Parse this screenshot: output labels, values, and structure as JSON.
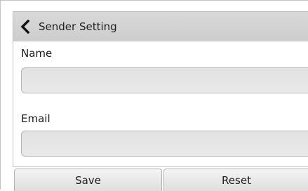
{
  "header": {
    "back_icon": "chevron-left-icon",
    "title": "Sender Setting"
  },
  "form": {
    "name_label": "Name",
    "name_value": "",
    "email_label": "Email",
    "email_value": ""
  },
  "footer": {
    "save_label": "Save",
    "reset_label": "Reset"
  },
  "colors": {
    "header_bg": "#d3d3d3",
    "field_bg": "#e6e6e6",
    "button_bg": "#e8e8e8"
  }
}
